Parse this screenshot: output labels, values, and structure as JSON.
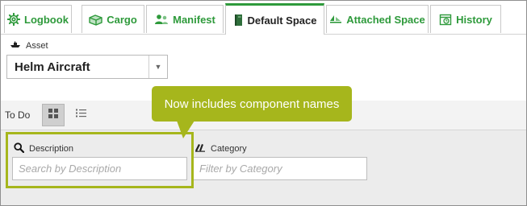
{
  "tabs": [
    {
      "label": "Logbook",
      "icon": "gear-icon"
    },
    {
      "label": "Cargo",
      "icon": "cargo-box-icon"
    },
    {
      "label": "Manifest",
      "icon": "people-icon"
    },
    {
      "label": "Default Space",
      "icon": "book-icon",
      "active": true
    },
    {
      "label": "Attached Space",
      "icon": "attached-space-icon"
    },
    {
      "label": "History",
      "icon": "history-calendar-icon"
    }
  ],
  "asset": {
    "label": "Asset",
    "icon": "ship-icon",
    "value": "Helm Aircraft"
  },
  "view": {
    "label": "To Do",
    "grid_icon": "grid-view-icon",
    "list_icon": "list-view-icon"
  },
  "fields": {
    "description": {
      "label": "Description",
      "icon": "search-icon",
      "placeholder": "Search by Description"
    },
    "category": {
      "label": "Category",
      "icon": "books-icon",
      "placeholder": "Filter by Category"
    }
  },
  "callout": {
    "text": "Now includes component names"
  },
  "colors": {
    "accent_green": "#2e9a3b",
    "callout_olive": "#a6b61c",
    "gray_bg": "#ececec"
  }
}
